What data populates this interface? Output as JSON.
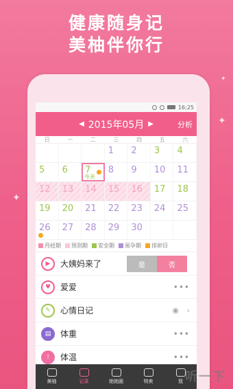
{
  "promo": {
    "line1": "健康随身记",
    "line2": "美柚伴你行"
  },
  "statusbar": {
    "time": "16:25"
  },
  "header": {
    "prev": "◀",
    "month": "2015年05月",
    "next": "▶",
    "share": "分析"
  },
  "weekdays": [
    "日",
    "一",
    "二",
    "三",
    "四",
    "五",
    "六"
  ],
  "calendar": {
    "rows": [
      [
        {
          "d": ""
        },
        {
          "d": ""
        },
        {
          "d": ""
        },
        {
          "d": "1",
          "c": "lavender"
        },
        {
          "d": "2",
          "c": "lavender"
        },
        {
          "d": "3",
          "c": "green"
        },
        {
          "d": "4",
          "c": "green"
        }
      ],
      [
        {
          "d": "5",
          "c": "green"
        },
        {
          "d": "6",
          "c": "green"
        },
        {
          "d": "7",
          "c": "green",
          "today": true
        },
        {
          "d": "8",
          "c": "lavender"
        },
        {
          "d": "9",
          "c": "lavender"
        },
        {
          "d": "10",
          "c": "lavender"
        },
        {
          "d": "11",
          "c": "lavender"
        }
      ],
      [
        {
          "d": "12",
          "c": "pink"
        },
        {
          "d": "13",
          "c": "pink"
        },
        {
          "d": "14",
          "c": "pink"
        },
        {
          "d": "15",
          "c": "pink"
        },
        {
          "d": "16",
          "c": "pink"
        },
        {
          "d": "17",
          "c": "green"
        },
        {
          "d": "18",
          "c": "green"
        }
      ],
      [
        {
          "d": "19",
          "c": "green"
        },
        {
          "d": "20",
          "c": "green"
        },
        {
          "d": "21",
          "c": "lavender"
        },
        {
          "d": "22",
          "c": "lavender"
        },
        {
          "d": "23",
          "c": "lavender"
        },
        {
          "d": "24",
          "c": "lavender"
        },
        {
          "d": "25",
          "c": "lavender"
        }
      ],
      [
        {
          "d": "26",
          "c": "lavender"
        },
        {
          "d": "27",
          "c": "lavender"
        },
        {
          "d": "28",
          "c": "lavender"
        },
        {
          "d": "29",
          "c": "lavender"
        },
        {
          "d": "30",
          "c": "lavender"
        },
        {
          "d": ""
        },
        {
          "d": ""
        }
      ]
    ],
    "today_label": "今天"
  },
  "legend": [
    {
      "label": "月经期",
      "color": "#f58fac"
    },
    {
      "label": "预测期",
      "color": "#fbc8d8"
    },
    {
      "label": "安全期",
      "color": "#9cc64c"
    },
    {
      "label": "易孕期",
      "color": "#b08fd6"
    },
    {
      "label": "排卵日",
      "color": "#f5a623"
    }
  ],
  "records": {
    "period": {
      "label": "大姨妈来了",
      "yes": "是",
      "no": "否"
    },
    "love": {
      "label": "爱爱"
    },
    "diary": {
      "label": "心情日记"
    },
    "weight": {
      "label": "体重"
    },
    "temp": {
      "label": "体温"
    },
    "dots": "•••"
  },
  "tabs": [
    {
      "label": "美柚"
    },
    {
      "label": "记录"
    },
    {
      "label": "她她圈"
    },
    {
      "label": "特卖"
    },
    {
      "label": "我"
    }
  ],
  "watermark": "听一下"
}
